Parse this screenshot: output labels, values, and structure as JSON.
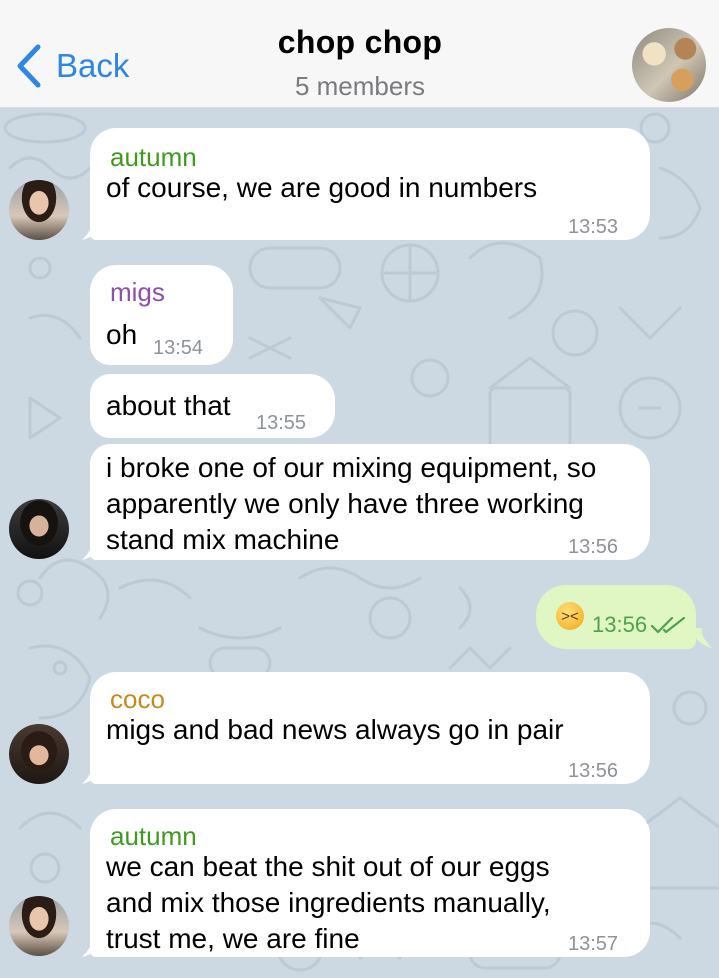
{
  "header": {
    "back_label": "Back",
    "title": "chop chop",
    "subtitle": "5 members",
    "accent_color": "#2c87e8"
  },
  "messages": [
    {
      "sender": "autumn",
      "sender_color": "#3e9b1f",
      "text": "of course, we are good in numbers",
      "time": "13:53"
    },
    {
      "sender": "migs",
      "sender_color": "#8a4fb0",
      "text": "oh",
      "time": "13:54"
    },
    {
      "text": "about that",
      "time": "13:55"
    },
    {
      "text": "i broke one of our mixing equipment, so\napparently we only have three working\nstand mix machine",
      "time": "13:56"
    },
    {
      "outgoing": true,
      "emoji": "persevering-face",
      "time": "13:56",
      "status": "read"
    },
    {
      "sender": "coco",
      "sender_color": "#c9891f",
      "text": "migs and bad news always go in pair",
      "time": "13:56"
    },
    {
      "sender": "autumn",
      "sender_color": "#3e9b1f",
      "text": "we can beat the shit out of our eggs\nand mix those ingredients manually,\ntrust me, we are fine",
      "time": "13:57"
    }
  ],
  "colors": {
    "outgoing_bubble": "#e0f6c3",
    "incoming_bubble": "#ffffff",
    "wallpaper": "#cdd9e2",
    "read_check": "#4aa34d"
  }
}
